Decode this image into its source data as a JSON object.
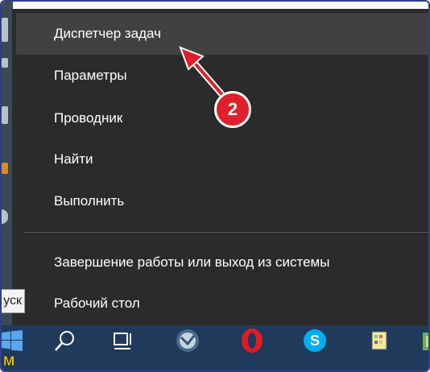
{
  "menu": {
    "items": [
      {
        "label": "Диспетчер задач",
        "highlighted": true
      },
      {
        "label": "Параметры"
      },
      {
        "label": "Проводник"
      },
      {
        "label": "Найти"
      },
      {
        "label": "Выполнить"
      },
      {
        "label": "Завершение работы или выход из системы"
      },
      {
        "label": "Рабочий стол"
      }
    ]
  },
  "tooltip": {
    "text": "уск"
  },
  "annotation": {
    "number": "2",
    "color": "#e0202a"
  },
  "taskbar": {
    "icons": [
      "windows-start-icon",
      "search-icon",
      "task-view-icon",
      "browser-icon",
      "opera-icon",
      "skype-icon",
      "app-icon",
      "app-icon"
    ],
    "bottom_label": "M"
  },
  "colors": {
    "menu_bg": "#2b2b2b",
    "menu_hover": "#414141",
    "taskbar": "#203a5c",
    "frame_border": "#2f3f8a"
  }
}
